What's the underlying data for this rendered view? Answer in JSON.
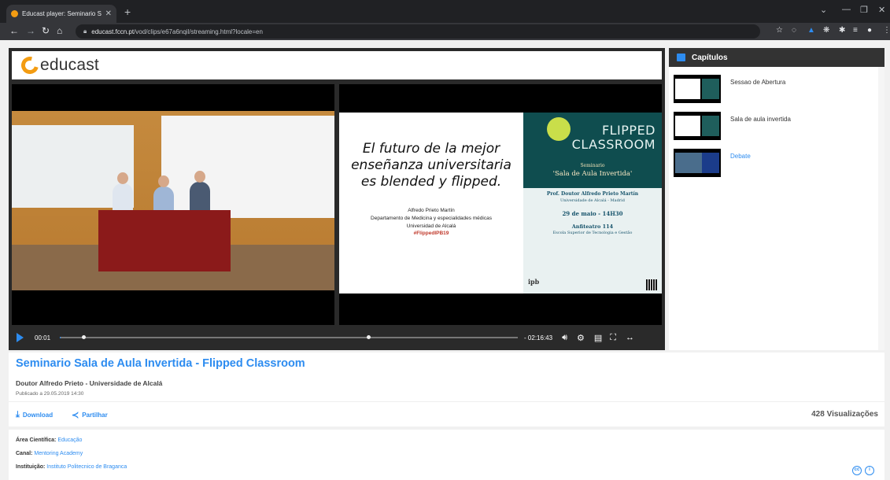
{
  "browser": {
    "tab_title": "Educast player: Seminario Sala de ",
    "url_host": "educast.fccn.pt",
    "url_path": "/vod/clips/e67a6nqil/streaming.html?locale=en"
  },
  "logo": {
    "text": "educast"
  },
  "player": {
    "slide": {
      "headline": "El futuro de la mejor enseñanza universitaria es blended y flipped.",
      "author": "Alfredo Prieto Martín",
      "dept": "Departamento de Medicina y especialidades médicas",
      "univ": "Universidad de Alcalá",
      "hashtag": "#FlippedIPB19"
    },
    "poster": {
      "title_line1": "FLIPPED",
      "title_line2": "CLASSROOM",
      "seminar": "Seminario",
      "seminar_title": "'Sala de Aula Invertida'",
      "speaker": "Prof. Doutor Alfredo Prieto Martín",
      "speaker_univ": "Universidade de Alcalá - Madrid",
      "date": "29 de maio - 14H30",
      "venue": "Anfiteatro 114",
      "venue_school": "Escola Superior de Tecnologia e Gestão",
      "logo": "ipb"
    },
    "current_time": "00:01",
    "remaining_time": "- 02:16:43",
    "progress": 0.001
  },
  "chapters": {
    "header": "Capítulos",
    "items": [
      {
        "label": "Sessao de Abertura",
        "active": false
      },
      {
        "label": "Sala de aula invertida",
        "active": false
      },
      {
        "label": "Debate",
        "active": true
      }
    ]
  },
  "video": {
    "title": "Seminario Sala de Aula Invertida - Flipped Classroom",
    "author": "Doutor Alfredo Prieto - Universidade de Alcalá",
    "published": "Publicado a 29.05.2019 14:30",
    "download": "Download",
    "share": "Partilhar",
    "views": "428 Visualizações"
  },
  "meta": {
    "area_label": "Área Científica:",
    "area_value": "Educação",
    "canal_label": "Canal:",
    "canal_value": "Mentoring Academy",
    "inst_label": "Instituição:",
    "inst_value": "Instituto Politecnico de Braganca"
  },
  "colors": {
    "accent": "#2d8cf0",
    "brand_orange": "#f39c12"
  }
}
